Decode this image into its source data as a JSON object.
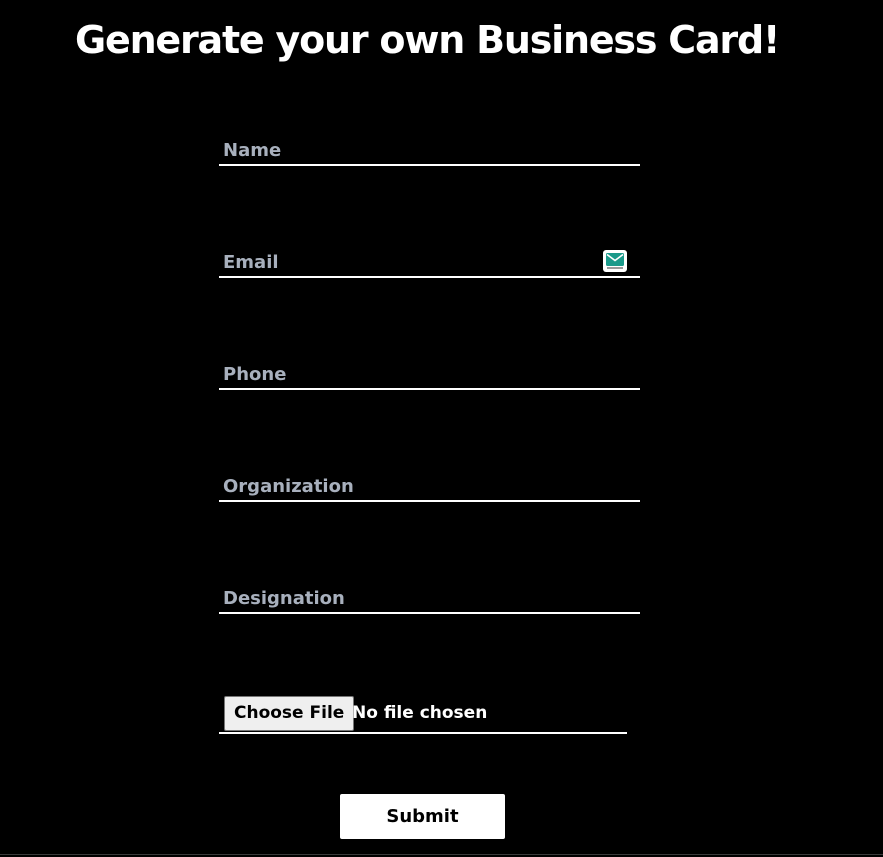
{
  "page": {
    "title": "Generate your own Business Card!"
  },
  "form": {
    "name_placeholder": "Name",
    "email_placeholder": "Email",
    "phone_placeholder": "Phone",
    "organization_placeholder": "Organization",
    "designation_placeholder": "Designation",
    "file_button_label": "Choose File",
    "file_status": "No file chosen",
    "submit_label": "Submit"
  },
  "icons": {
    "email_extension": "mail-envelope-icon"
  },
  "colors": {
    "background": "#000000",
    "text": "#ffffff",
    "placeholder": "#a8b0bd",
    "icon_accent": "#1a9a8a"
  }
}
